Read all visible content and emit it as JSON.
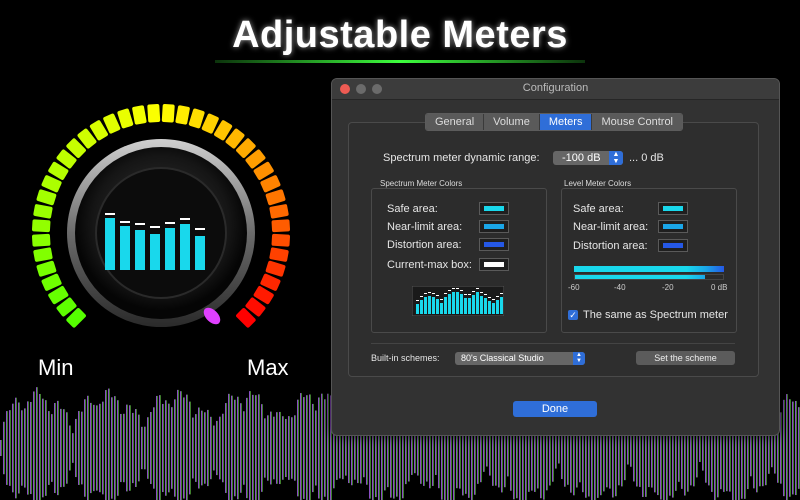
{
  "headline": "Adjustable Meters",
  "knob": {
    "min_label": "Min",
    "max_label": "Max"
  },
  "window": {
    "title": "Configuration",
    "tabs": [
      {
        "label": "General",
        "active": false
      },
      {
        "label": "Volume",
        "active": false
      },
      {
        "label": "Meters",
        "active": true
      },
      {
        "label": "Mouse Control",
        "active": false
      }
    ],
    "range": {
      "label": "Spectrum meter dynamic range:",
      "value": "-100 dB",
      "suffix": "... 0 dB"
    },
    "spectrum_colors": {
      "title": "Spectrum Meter Colors",
      "items": [
        {
          "label": "Safe area:",
          "color": "#19d8ec"
        },
        {
          "label": "Near-limit area:",
          "color": "#1aa6e8"
        },
        {
          "label": "Distortion area:",
          "color": "#2558e6"
        },
        {
          "label": "Current-max box:",
          "color": "#ffffff"
        }
      ]
    },
    "level_colors": {
      "title": "Level Meter Colors",
      "items": [
        {
          "label": "Safe area:",
          "color": "#19d8ec"
        },
        {
          "label": "Near-limit area:",
          "color": "#1aa6e8"
        },
        {
          "label": "Distortion area:",
          "color": "#2558e6"
        }
      ],
      "scale": [
        "-60",
        "-40",
        "-20",
        "0 dB"
      ],
      "same_as_label": "The same as Spectrum meter",
      "same_as_checked": true
    },
    "schemes": {
      "label": "Built-in schemes:",
      "value": "80's Classical Studio",
      "set_button": "Set the scheme"
    },
    "done_button": "Done"
  }
}
